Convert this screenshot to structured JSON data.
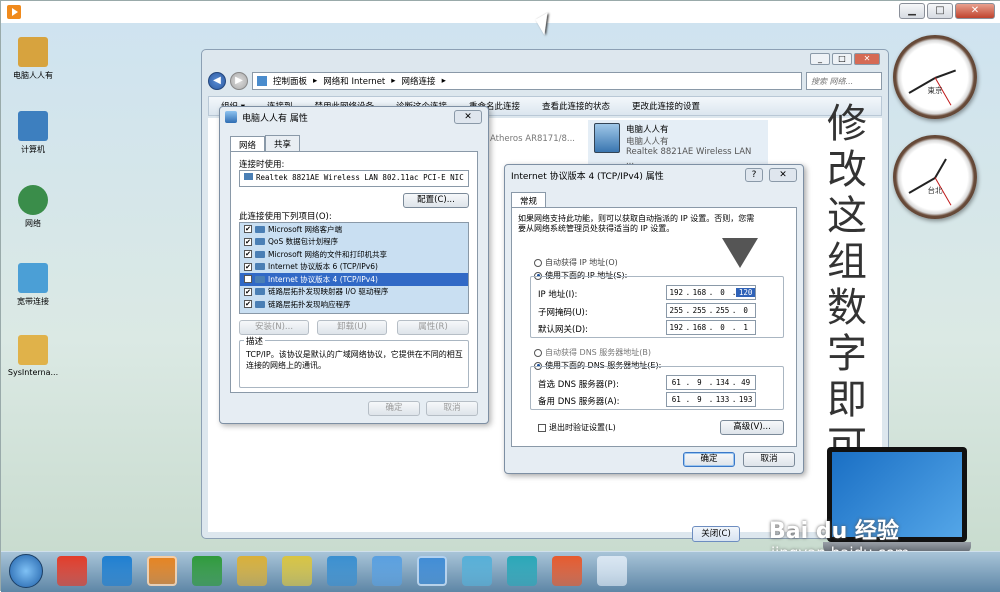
{
  "outer_window": {
    "buttons": [
      "▁",
      "□",
      "✕"
    ]
  },
  "desktop_icons": [
    {
      "label": "电脑人人有",
      "color": "#d7a33e"
    },
    {
      "label": "计算机",
      "color": "#3d7fbf"
    },
    {
      "label": "网络",
      "color": "#3a8d4a"
    },
    {
      "label": "宽带连接",
      "color": "#4b9fd6"
    },
    {
      "label": "SysInterna...",
      "color": "#e0b24a"
    }
  ],
  "explorer": {
    "breadcrumb": [
      "控制面板",
      "网络和 Internet",
      "网络连接"
    ],
    "search_placeholder": "搜索 网络...",
    "toolbar": [
      "组织 ▾",
      "连接到",
      "禁用此网络设备",
      "诊断这个连接",
      "重命名此连接",
      "查看此连接的状态",
      "更改此连接的设置"
    ],
    "adapter_left": "Atheros AR8171/8...",
    "adapter": {
      "name": "电脑人人有",
      "network": "电脑人人有",
      "device": "Realtek 8821AE Wireless LAN ..."
    },
    "close_button": "关闭(C)"
  },
  "props_dialog": {
    "title": "电脑人人有 属性",
    "close": "✕",
    "tabs": [
      "网络",
      "共享"
    ],
    "connect_using_label": "连接时使用:",
    "adapter_name": "Realtek 8821AE Wireless LAN 802.11ac PCI-E NIC",
    "configure_button": "配置(C)...",
    "items_label": "此连接使用下列项目(O):",
    "items": [
      "Microsoft 网络客户端",
      "QoS 数据包计划程序",
      "Microsoft 网络的文件和打印机共享",
      "Internet 协议版本 6 (TCP/IPv6)",
      "Internet 协议版本 4 (TCP/IPv4)",
      "链路层拓扑发现映射器 I/O 驱动程序",
      "链路层拓扑发现响应程序"
    ],
    "install_button": "安装(N)...",
    "uninstall_button": "卸载(U)",
    "properties_button": "属性(R)",
    "description_label": "描述",
    "description": "TCP/IP。该协议是默认的广域网络协议，它提供在不同的相互连接的网络上的通讯。",
    "ok_button": "确定",
    "cancel_button": "取消"
  },
  "tcp_dialog": {
    "title": "Internet 协议版本 4 (TCP/IPv4) 属性",
    "help": "?",
    "close": "✕",
    "tab": "常规",
    "intro": "如果网络支持此功能，则可以获取自动指派的 IP 设置。否则，您需要从网络系统管理员处获得适当的 IP 设置。",
    "auto_ip": "自动获得 IP 地址(O)",
    "manual_ip": "使用下面的 IP 地址(S):",
    "ip_label": "IP 地址(I):",
    "ip": [
      "192",
      "168",
      "0",
      "120"
    ],
    "mask_label": "子网掩码(U):",
    "mask": [
      "255",
      "255",
      "255",
      "0"
    ],
    "gateway_label": "默认网关(D):",
    "gateway": [
      "192",
      "168",
      "0",
      "1"
    ],
    "auto_dns": "自动获得 DNS 服务器地址(B)",
    "manual_dns": "使用下面的 DNS 服务器地址(E):",
    "dns1_label": "首选 DNS 服务器(P):",
    "dns1": [
      "61",
      "9",
      "134",
      "49"
    ],
    "dns2_label": "备用 DNS 服务器(A):",
    "dns2": [
      "61",
      "9",
      "133",
      "193"
    ],
    "validate": "退出时验证设置(L)",
    "advanced_button": "高级(V)...",
    "ok_button": "确定",
    "cancel_button": "取消"
  },
  "clocks": [
    {
      "city": "東京"
    },
    {
      "city": "台北"
    }
  ],
  "annotation": "修改这组数字即可",
  "watermark": {
    "brand": "Bai du 经验",
    "url": "jingyan.baidu.com"
  },
  "taskbar_colors": [
    "#e23c2a",
    "#1f7fd1",
    "#e7831f",
    "#2f9a3c",
    "#d9b03a",
    "#d8c443",
    "#3a8fd0",
    "#5aa0e0",
    "#3f8cd6",
    "#57b0d8",
    "#2aa7b8",
    "#e65a2e",
    "#d9e6f2"
  ]
}
